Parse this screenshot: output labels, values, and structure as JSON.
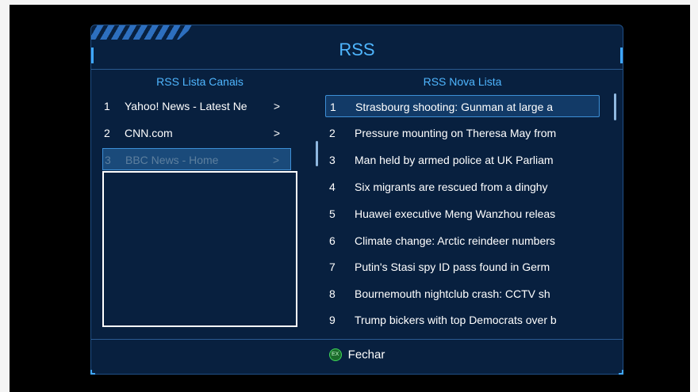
{
  "title": "RSS",
  "channels": {
    "header": "RSS Lista Canais",
    "items": [
      {
        "num": "1",
        "label": "Yahoo! News - Latest Ne",
        "arrow": ">"
      },
      {
        "num": "2",
        "label": "CNN.com",
        "arrow": ">"
      },
      {
        "num": "3",
        "label": "BBC News - Home",
        "arrow": ">"
      }
    ]
  },
  "news": {
    "header": "RSS Nova Lista",
    "items": [
      {
        "num": "1",
        "label": "Strasbourg shooting: Gunman at large a"
      },
      {
        "num": "2",
        "label": "Pressure mounting on Theresa May from"
      },
      {
        "num": "3",
        "label": "Man held by armed police at UK Parliam"
      },
      {
        "num": "4",
        "label": "Six migrants are rescued from a dinghy"
      },
      {
        "num": "5",
        "label": "Huawei executive Meng Wanzhou releas"
      },
      {
        "num": "6",
        "label": "Climate change: Arctic reindeer numbers"
      },
      {
        "num": "7",
        "label": "Putin's Stasi spy ID pass found in Germ"
      },
      {
        "num": "8",
        "label": "Bournemouth nightclub crash: CCTV sh"
      },
      {
        "num": "9",
        "label": "Trump bickers with top Democrats over b"
      }
    ]
  },
  "footer": {
    "button_icon": "EX",
    "label": "Fechar"
  },
  "colors": {
    "accent": "#4fb6ff",
    "panel": "#08203f",
    "selection": "#1a4a7a",
    "exit_button": "#1b6b2a"
  }
}
